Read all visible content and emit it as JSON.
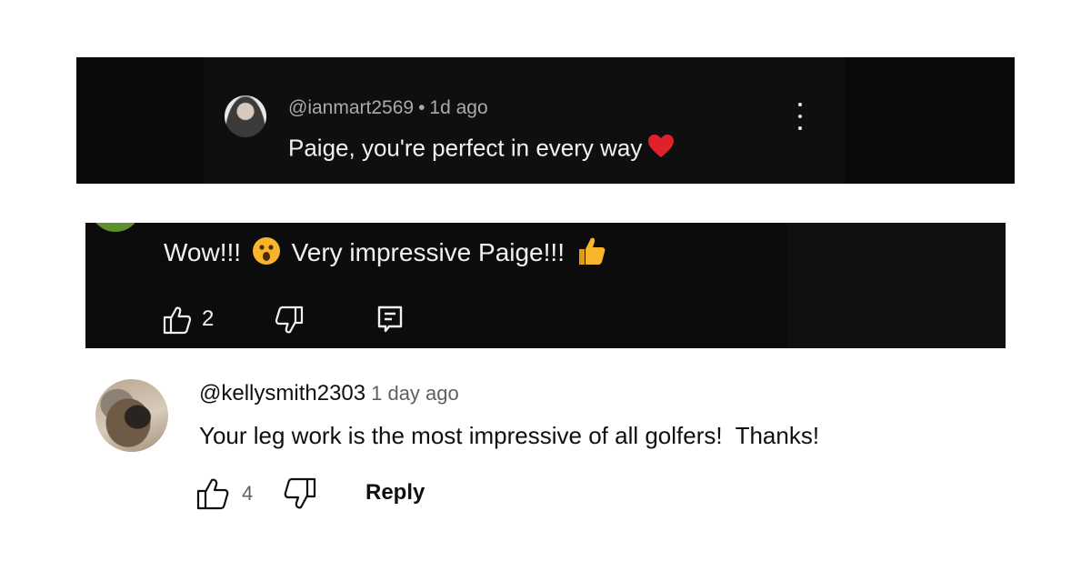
{
  "comments": [
    {
      "handle": "@ianmart2569",
      "separator": "•",
      "time": "1d ago",
      "text": "Paige, you're perfect  in every way",
      "emoji": "red-heart-icon"
    },
    {
      "text_before": "Wow!!!",
      "emoji_mid": "astonished-face-icon",
      "text_after": "Very impressive Paige!!!",
      "emoji_end": "thumbs-up-emoji-icon",
      "like_count": "2"
    },
    {
      "handle": "@kellysmith2303",
      "time": "1 day ago",
      "text": "Your leg work is the most impressive of all golfers!  Thanks!",
      "like_count": "4",
      "reply_label": "Reply"
    }
  ],
  "colors": {
    "dark_background": "#0b0b0b",
    "dark_text": "#f1f1f1",
    "dark_meta": "#aaaaaa",
    "light_text": "#0f0f0f",
    "light_meta": "#606060",
    "heart": "#e0202a",
    "emoji_yellow": "#f7b52c"
  }
}
